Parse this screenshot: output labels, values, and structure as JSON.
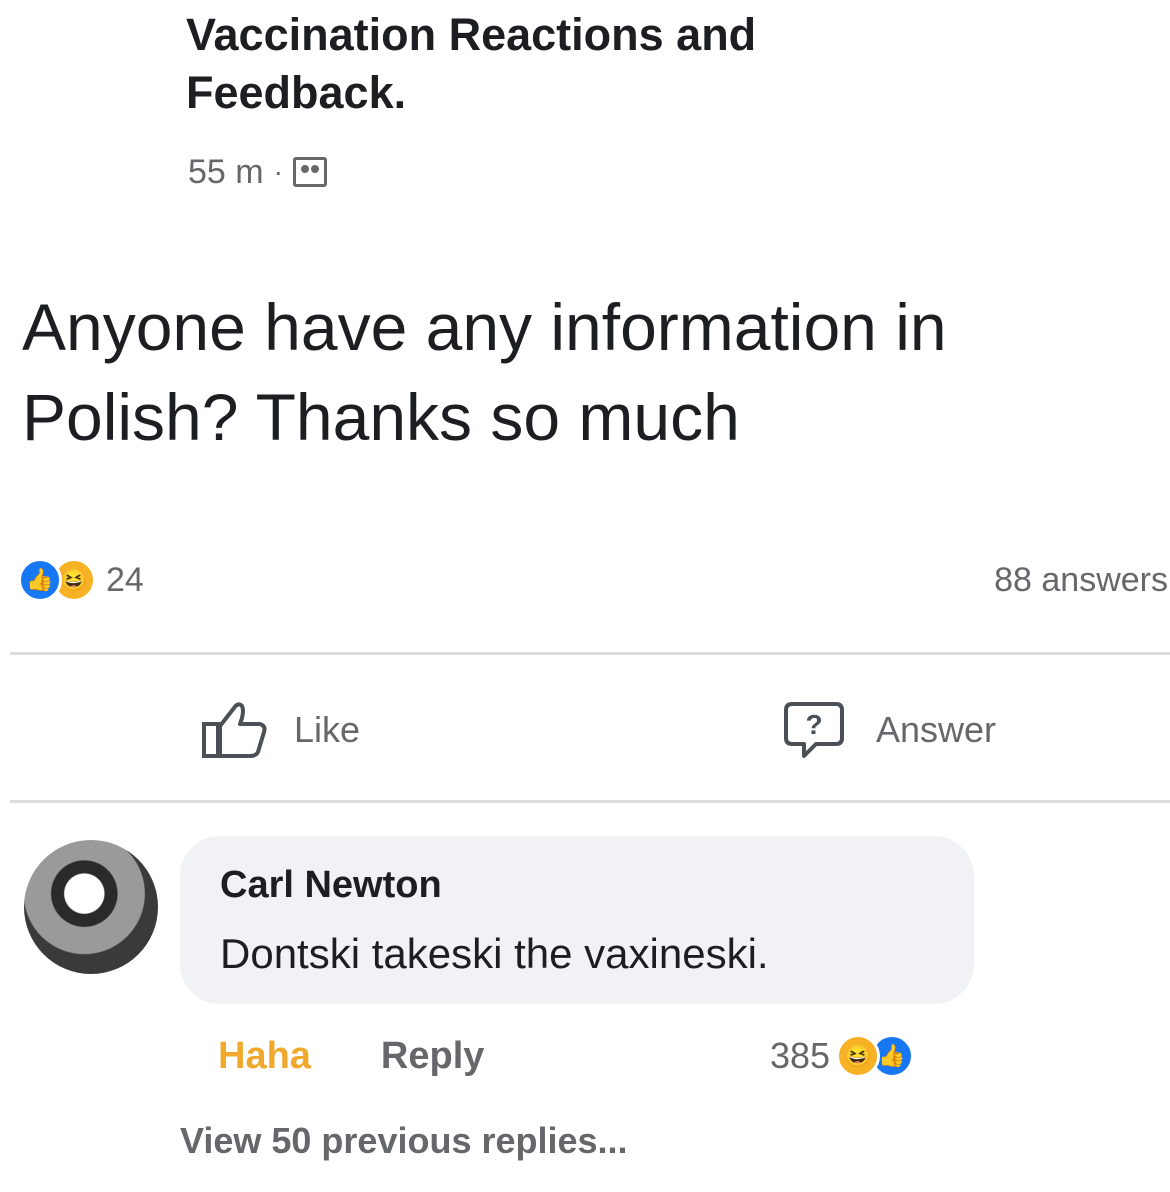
{
  "post": {
    "group_title": "Vaccination Reactions and Feedback.",
    "time": "55 m",
    "privacy_icon": "group-icon",
    "text": "Anyone have any information in Polish? Thanks so much",
    "reaction_icons": [
      "like-reaction-icon",
      "haha-reaction-icon"
    ],
    "reaction_count": "24",
    "answers_count": "88 answers",
    "actions": {
      "like_label": "Like",
      "answer_label": "Answer"
    }
  },
  "comment": {
    "author": "Carl Newton",
    "text": "Dontski takeski the vaxineski.",
    "reaction_label": "Haha",
    "reply_label": "Reply",
    "reaction_count": "385",
    "reaction_icons": [
      "haha-reaction-icon",
      "like-reaction-icon"
    ],
    "view_previous": "View 50 previous replies..."
  },
  "colors": {
    "like_blue": "#1877f2",
    "haha_yellow": "#f7b125",
    "haha_label": "#f0a92c",
    "secondary_text": "#65676b",
    "bubble_bg": "#f0f2f5"
  }
}
